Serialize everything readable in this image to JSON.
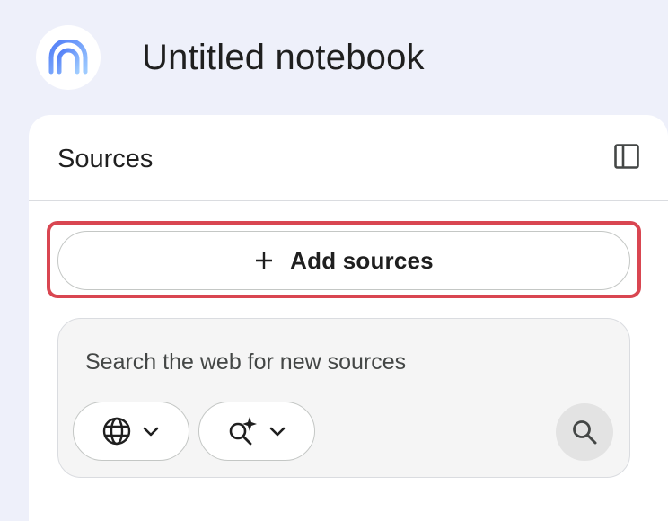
{
  "notebook": {
    "title": "Untitled notebook",
    "logo_icon": "notebooklm-logo-icon"
  },
  "sources_panel": {
    "title": "Sources",
    "collapse_icon": "sidebar-panel-icon",
    "add_sources": {
      "label": "Add sources",
      "icon": "plus-icon",
      "highlight_color": "#d94651"
    },
    "web_search": {
      "placeholder": "Search the web for new sources",
      "source_selector_icon": "globe-icon",
      "mode_selector_icon": "sparkle-search-icon",
      "dropdown_icon": "chevron-down-icon",
      "submit_icon": "search-icon"
    }
  },
  "colors": {
    "page_background": "#eef0fa",
    "panel_background": "#ffffff",
    "search_box_background": "#f5f5f5",
    "logo_gradient": [
      "#4f7bf7",
      "#9ecbff"
    ]
  }
}
